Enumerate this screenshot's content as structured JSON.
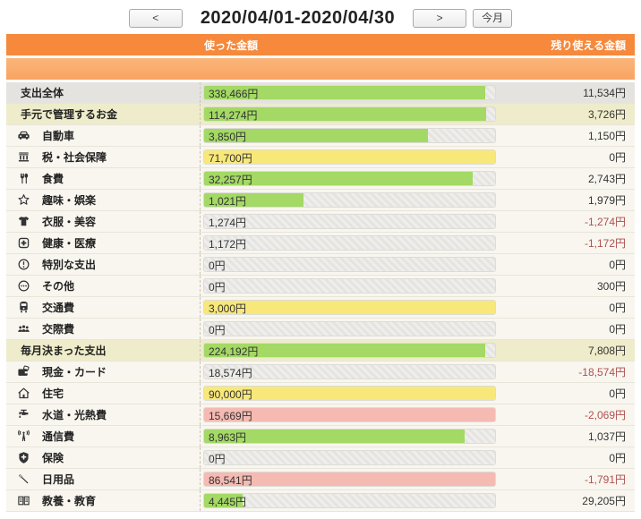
{
  "nav": {
    "prev_label": "<",
    "next_label": ">",
    "today_label": "今月",
    "title": "2020/04/01-2020/04/30"
  },
  "table": {
    "headers": {
      "spent": "使った金額",
      "remaining": "残り使える金額"
    },
    "rows": [
      {
        "type": "total",
        "name": "支出全体",
        "spent": "338,466円",
        "remaining": "11,534円",
        "bar": {
          "pct": 96.7,
          "color": "green"
        }
      },
      {
        "type": "section",
        "name": "手元で管理するお金",
        "spent": "114,274円",
        "remaining": "3,726円",
        "bar": {
          "pct": 96.8,
          "color": "green"
        }
      },
      {
        "type": "item",
        "icon": "car-icon",
        "name": "自動車",
        "spent": "3,850円",
        "remaining": "1,150円",
        "bar": {
          "pct": 77,
          "color": "green"
        }
      },
      {
        "type": "item",
        "icon": "bank-icon",
        "name": "税・社会保障",
        "spent": "71,700円",
        "remaining": "0円",
        "bar": {
          "pct": 100,
          "color": "yellow"
        }
      },
      {
        "type": "item",
        "icon": "cutlery-icon",
        "name": "食費",
        "spent": "32,257円",
        "remaining": "2,743円",
        "bar": {
          "pct": 92.2,
          "color": "green"
        }
      },
      {
        "type": "item",
        "icon": "star-icon",
        "name": "趣味・娯楽",
        "spent": "1,021円",
        "remaining": "1,979円",
        "bar": {
          "pct": 34,
          "color": "green"
        }
      },
      {
        "type": "item",
        "icon": "shirt-icon",
        "name": "衣服・美容",
        "spent": "1,274円",
        "remaining": "-1,274円",
        "bar": {
          "pct": 0,
          "color": "none"
        }
      },
      {
        "type": "item",
        "icon": "medical-cross-icon",
        "name": "健康・医療",
        "spent": "1,172円",
        "remaining": "-1,172円",
        "bar": {
          "pct": 0,
          "color": "none"
        }
      },
      {
        "type": "item",
        "icon": "exclamation-circle-icon",
        "name": "特別な支出",
        "spent": "0円",
        "remaining": "0円",
        "bar": {
          "pct": 0,
          "color": "none"
        }
      },
      {
        "type": "item",
        "icon": "ellipsis-circle-icon",
        "name": "その他",
        "spent": "0円",
        "remaining": "300円",
        "bar": {
          "pct": 0,
          "color": "none"
        }
      },
      {
        "type": "item",
        "icon": "train-icon",
        "name": "交通費",
        "spent": "3,000円",
        "remaining": "0円",
        "bar": {
          "pct": 100,
          "color": "yellow"
        }
      },
      {
        "type": "item",
        "icon": "people-icon",
        "name": "交際費",
        "spent": "0円",
        "remaining": "0円",
        "bar": {
          "pct": 0,
          "color": "none"
        }
      },
      {
        "type": "section",
        "name": "毎月決まった支出",
        "spent": "224,192円",
        "remaining": "7,808円",
        "bar": {
          "pct": 96.6,
          "color": "green"
        }
      },
      {
        "type": "item",
        "icon": "wallet-icon",
        "name": "現金・カード",
        "spent": "18,574円",
        "remaining": "-18,574円",
        "bar": {
          "pct": 0,
          "color": "none"
        }
      },
      {
        "type": "item",
        "icon": "house-icon",
        "name": "住宅",
        "spent": "90,000円",
        "remaining": "0円",
        "bar": {
          "pct": 100,
          "color": "yellow"
        }
      },
      {
        "type": "item",
        "icon": "faucet-icon",
        "name": "水道・光熱費",
        "spent": "15,669円",
        "remaining": "-2,069円",
        "bar": {
          "pct": 100,
          "color": "pink"
        }
      },
      {
        "type": "item",
        "icon": "antenna-icon",
        "name": "通信費",
        "spent": "8,963円",
        "remaining": "1,037円",
        "bar": {
          "pct": 89.6,
          "color": "green"
        }
      },
      {
        "type": "item",
        "icon": "shield-icon",
        "name": "保険",
        "spent": "0円",
        "remaining": "0円",
        "bar": {
          "pct": 0,
          "color": "none"
        }
      },
      {
        "type": "item",
        "icon": "toothbrush-icon",
        "name": "日用品",
        "spent": "86,541円",
        "remaining": "-1,791円",
        "bar": {
          "pct": 100,
          "color": "pink"
        }
      },
      {
        "type": "item",
        "icon": "book-icon",
        "name": "教養・教育",
        "spent": "4,445円",
        "remaining": "29,205円",
        "bar": {
          "pct": 13.2,
          "color": "green"
        }
      }
    ]
  },
  "colors": {
    "header_orange": "#f6893c",
    "subheader_orange": "#f8a463",
    "bar_within_budget": "#a3d964",
    "bar_at_budget": "#f8e87a",
    "bar_over_budget": "#f5bab2",
    "negative_text": "#b05050",
    "total_row_bg": "#e4e3df",
    "section_row_bg": "#eeecca"
  }
}
